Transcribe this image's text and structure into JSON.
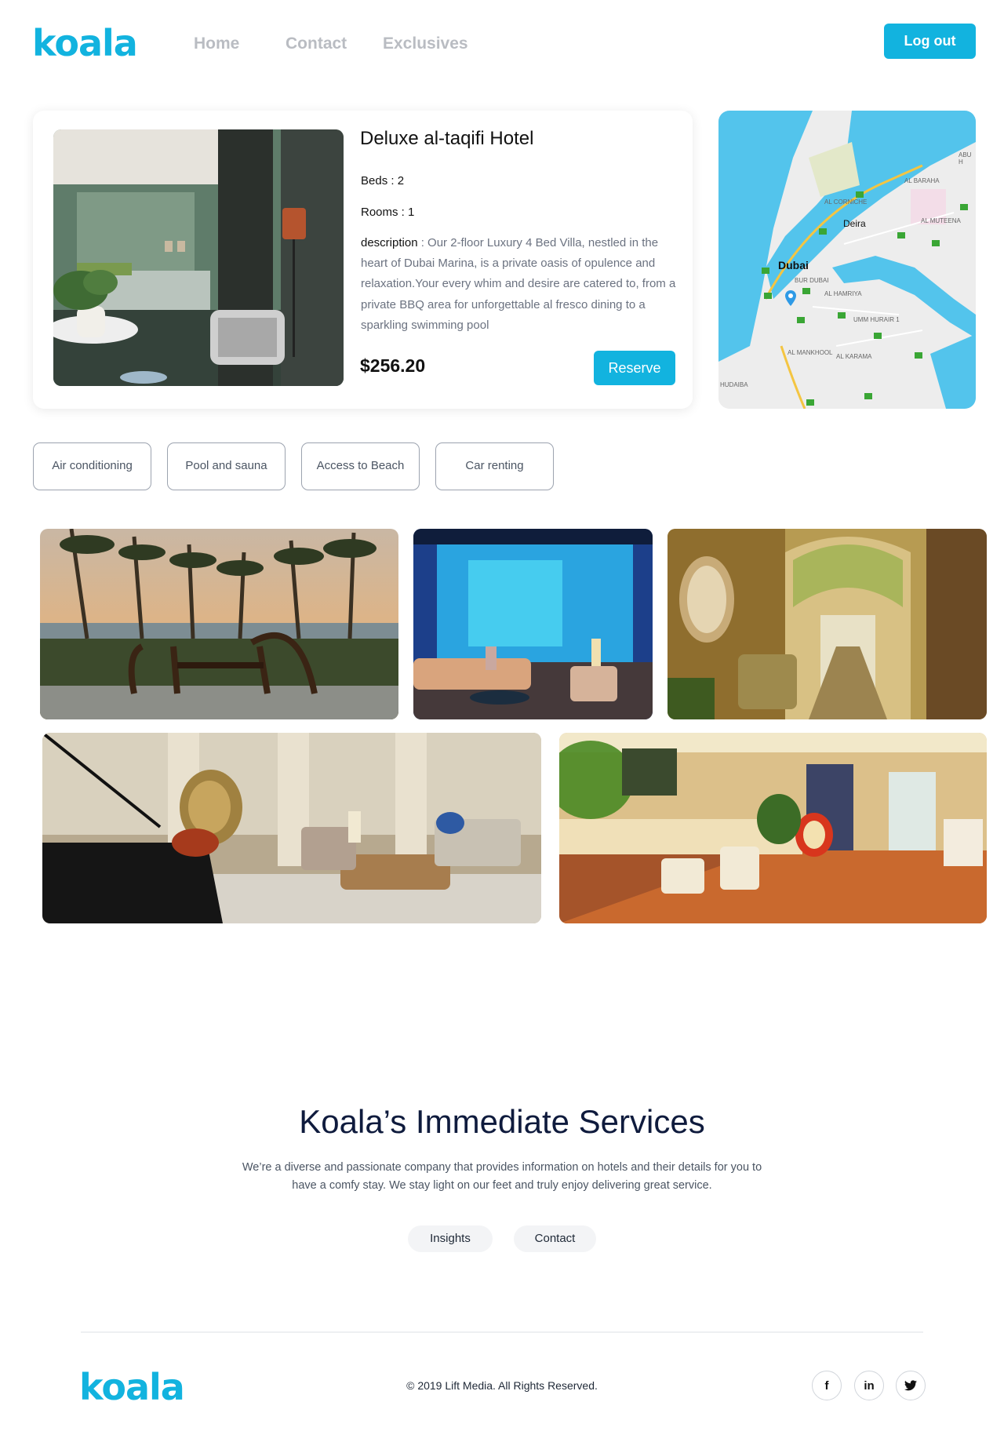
{
  "brand": {
    "name": "koala",
    "accent": "#12b3df"
  },
  "nav": {
    "items": [
      "Home",
      "Contact",
      "Exclusives"
    ],
    "logout_label": "Log out"
  },
  "hotel": {
    "name": "Deluxe al-taqifi Hotel",
    "beds_label": "Beds : 2",
    "rooms_label": "Rooms : 1",
    "description_label": "description",
    "description_text": " : Our 2-floor Luxury 4 Bed Villa, nestled in the heart of Dubai Marina, is a private oasis of opulence and relaxation.Your every whim and desire are catered to, from a private BBQ area for unforgettable al fresco dining to a sparkling swimming pool",
    "price": "$256.20",
    "reserve_label": "Reserve"
  },
  "map": {
    "labels": [
      "Dubai",
      "Deira",
      "BUR DUBAI",
      "AL HAMRIYA",
      "AL CORNICHE",
      "AL BARAHA",
      "AL MUTEENA",
      "UMM HURAIR 1",
      "AL MANKHOOL",
      "AL KARAMA",
      "HUDAIBA",
      "ABU H"
    ]
  },
  "amenities": [
    "Air conditioning",
    "Pool and sauna",
    "Access to Beach",
    "Car renting"
  ],
  "services": {
    "title": "Koala’s Immediate Services",
    "text": "We’re a diverse and passionate company that provides information on hotels and their details for you to have a comfy stay. We stay light on our feet and truly enjoy delivering great service.",
    "buttons": [
      "Insights",
      "Contact"
    ]
  },
  "footer": {
    "copyright": "© 2019 Lift Media. All Rights Reserved.",
    "social": [
      {
        "icon": "facebook-icon",
        "glyph": "f"
      },
      {
        "icon": "linkedin-icon",
        "glyph": "in"
      },
      {
        "icon": "twitter-icon",
        "glyph": "🐦"
      }
    ]
  }
}
